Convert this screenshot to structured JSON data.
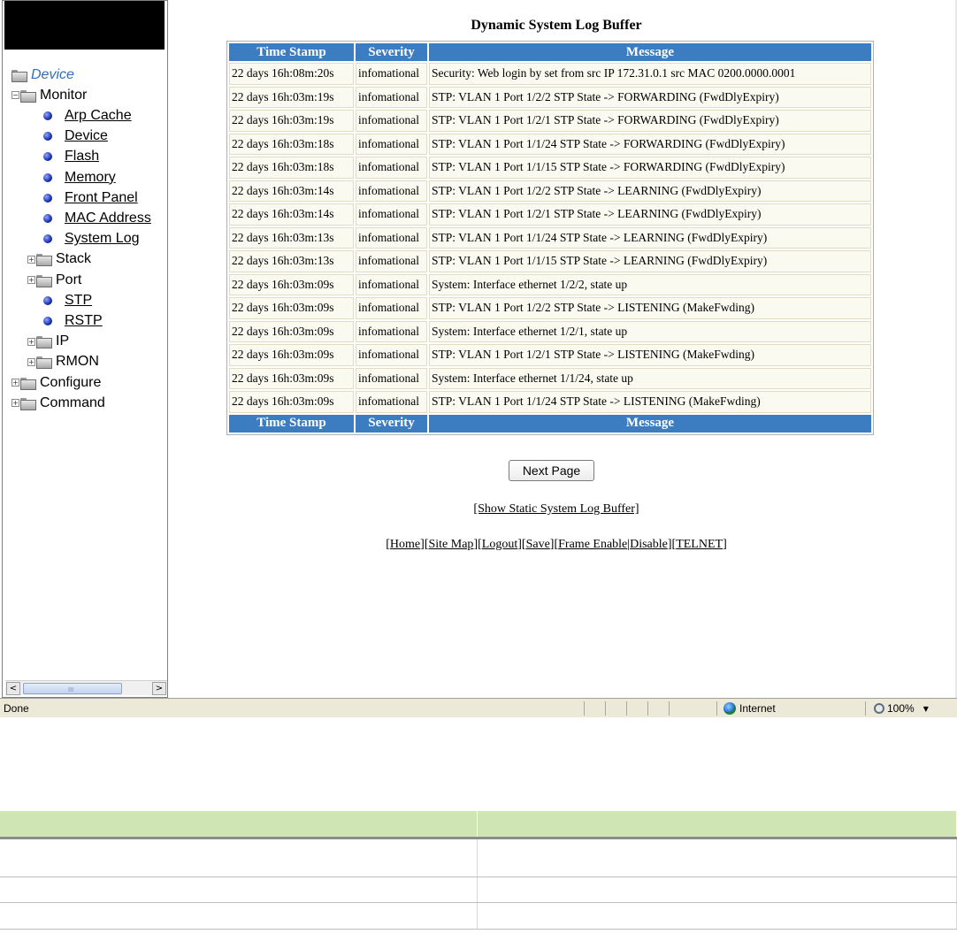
{
  "nav": {
    "tree": [
      {
        "label": "Device",
        "kind": "root",
        "icon": "folder-icon",
        "indent": 0
      },
      {
        "label": "Monitor",
        "kind": "folder-open",
        "icon": "folder-icon",
        "indent": 0
      },
      {
        "label": "Arp Cache",
        "kind": "leaf",
        "icon": "bullet-icon",
        "indent": 2
      },
      {
        "label": "Device",
        "kind": "leaf",
        "icon": "bullet-icon",
        "indent": 2
      },
      {
        "label": "Flash",
        "kind": "leaf",
        "icon": "bullet-icon",
        "indent": 2
      },
      {
        "label": "Memory",
        "kind": "leaf",
        "icon": "bullet-icon",
        "indent": 2
      },
      {
        "label": "Front Panel",
        "kind": "leaf",
        "icon": "bullet-icon",
        "indent": 2
      },
      {
        "label": "MAC Address",
        "kind": "leaf",
        "icon": "bullet-icon",
        "indent": 2
      },
      {
        "label": "System Log",
        "kind": "leaf",
        "icon": "bullet-icon",
        "indent": 2
      },
      {
        "label": "Stack",
        "kind": "folder-closed",
        "icon": "folder-icon",
        "indent": 1
      },
      {
        "label": "Port",
        "kind": "folder-closed",
        "icon": "folder-icon",
        "indent": 1
      },
      {
        "label": "STP",
        "kind": "leaf",
        "icon": "bullet-icon",
        "indent": 2
      },
      {
        "label": "RSTP",
        "kind": "leaf",
        "icon": "bullet-icon",
        "indent": 2
      },
      {
        "label": "IP",
        "kind": "folder-closed",
        "icon": "folder-icon",
        "indent": 1
      },
      {
        "label": "RMON",
        "kind": "folder-closed",
        "icon": "folder-icon",
        "indent": 1
      },
      {
        "label": "Configure",
        "kind": "folder-closed",
        "icon": "folder-icon",
        "indent": 0
      },
      {
        "label": "Command",
        "kind": "folder-closed",
        "icon": "folder-icon",
        "indent": 0
      }
    ],
    "scroll_left": "<",
    "scroll_grip": "III",
    "scroll_right": ">"
  },
  "log": {
    "title": "Dynamic System Log Buffer",
    "columns": [
      "Time Stamp",
      "Severity",
      "Message"
    ],
    "rows": [
      [
        "22 days 16h:08m:20s",
        "infomational",
        "Security: Web login by set from src IP 172.31.0.1 src MAC 0200.0000.0001"
      ],
      [
        "22 days 16h:03m:19s",
        "infomational",
        "STP: VLAN 1 Port 1/2/2 STP State -> FORWARDING (FwdDlyExpiry)"
      ],
      [
        "22 days 16h:03m:19s",
        "infomational",
        "STP: VLAN 1 Port 1/2/1 STP State -> FORWARDING (FwdDlyExpiry)"
      ],
      [
        "22 days 16h:03m:18s",
        "infomational",
        "STP: VLAN 1 Port 1/1/24 STP State -> FORWARDING (FwdDlyExpiry)"
      ],
      [
        "22 days 16h:03m:18s",
        "infomational",
        "STP: VLAN 1 Port 1/1/15 STP State -> FORWARDING (FwdDlyExpiry)"
      ],
      [
        "22 days 16h:03m:14s",
        "infomational",
        "STP: VLAN 1 Port 1/2/2 STP State -> LEARNING (FwdDlyExpiry)"
      ],
      [
        "22 days 16h:03m:14s",
        "infomational",
        "STP: VLAN 1 Port 1/2/1 STP State -> LEARNING (FwdDlyExpiry)"
      ],
      [
        "22 days 16h:03m:13s",
        "infomational",
        "STP: VLAN 1 Port 1/1/24 STP State -> LEARNING (FwdDlyExpiry)"
      ],
      [
        "22 days 16h:03m:13s",
        "infomational",
        "STP: VLAN 1 Port 1/1/15 STP State -> LEARNING (FwdDlyExpiry)"
      ],
      [
        "22 days 16h:03m:09s",
        "infomational",
        "System: Interface ethernet 1/2/2, state up"
      ],
      [
        "22 days 16h:03m:09s",
        "infomational",
        "STP: VLAN 1 Port 1/2/2 STP State -> LISTENING (MakeFwding)"
      ],
      [
        "22 days 16h:03m:09s",
        "infomational",
        "System: Interface ethernet 1/2/1, state up"
      ],
      [
        "22 days 16h:03m:09s",
        "infomational",
        "STP: VLAN 1 Port 1/2/1 STP State -> LISTENING (MakeFwding)"
      ],
      [
        "22 days 16h:03m:09s",
        "infomational",
        "System: Interface ethernet 1/1/24, state up"
      ],
      [
        "22 days 16h:03m:09s",
        "infomational",
        "STP: VLAN 1 Port 1/1/24 STP State -> LISTENING (MakeFwding)"
      ]
    ],
    "next_page_label": "Next Page",
    "static_link_label": "[Show Static System Log Buffer]",
    "footer_links": [
      "Home",
      "Site Map",
      "Logout",
      "Save",
      "Frame Enable",
      "Disable",
      "TELNET"
    ]
  },
  "status_bar": {
    "status_text": "Done",
    "zone_text": "Internet",
    "zoom_text": "100%",
    "zoom_arrow": "▼"
  },
  "colors": {
    "table_header_bg": "#3b7dc0",
    "table_cell_bg": "#fafaf0",
    "doc_table_header_bg": "#cfe5b4",
    "device_link_color": "#2f6fbf"
  }
}
